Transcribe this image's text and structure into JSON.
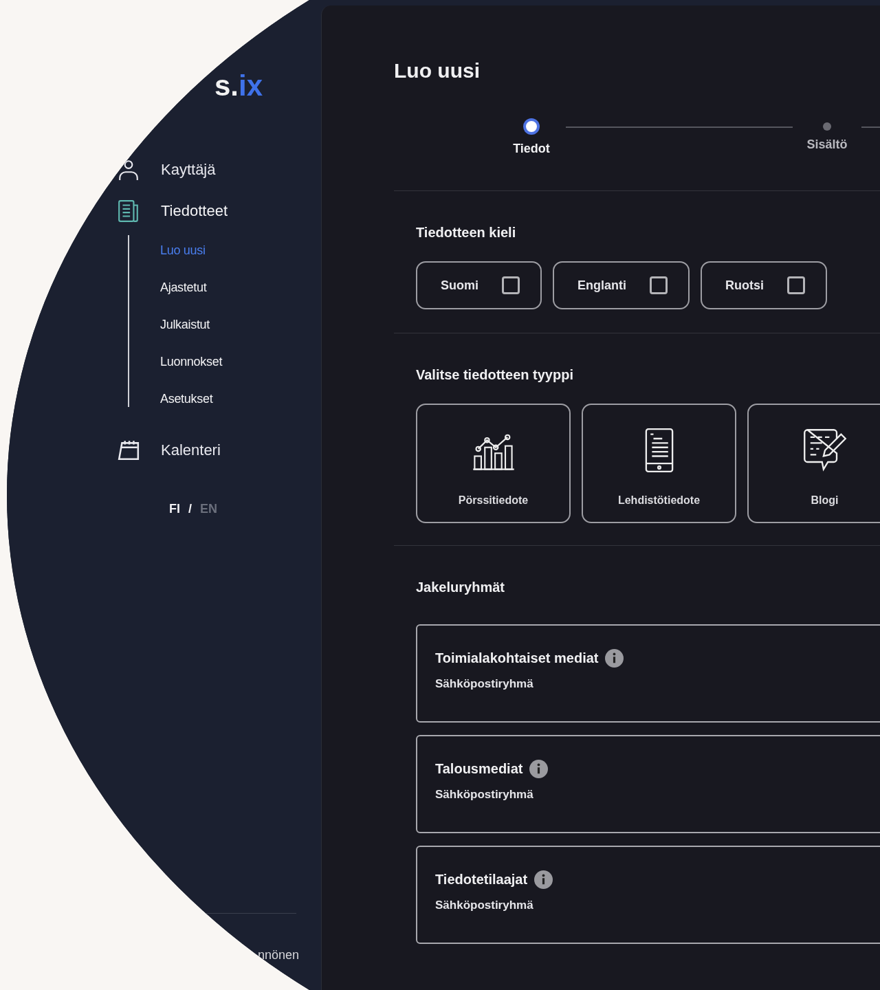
{
  "sidebar": {
    "logo_main": "s.",
    "logo_accent": "ix",
    "nav": [
      {
        "label": "Kayttäjä",
        "kind": "user",
        "selected": false
      },
      {
        "label": "Tiedotteet",
        "kind": "news",
        "selected": true,
        "children": [
          {
            "label": "Luo uusi",
            "selected": true
          },
          {
            "label": "Ajastetut",
            "selected": false
          },
          {
            "label": "Julkaistut",
            "selected": false
          },
          {
            "label": "Luonnokset",
            "selected": false
          },
          {
            "label": "Asetukset",
            "selected": false
          }
        ]
      },
      {
        "label": "Kalenteri",
        "kind": "calendar",
        "selected": false
      }
    ],
    "languages": [
      {
        "label": "FI",
        "selected": true
      },
      {
        "label": "EN",
        "selected": false
      }
    ],
    "language_separator": "/",
    "user_name": "nnönen"
  },
  "page": {
    "title": "Luo uusi",
    "steps": [
      {
        "label": "Tiedot",
        "selected": true
      },
      {
        "label": "Sisältö",
        "selected": false
      }
    ],
    "language_section": {
      "heading": "Tiedotteen kieli",
      "options": [
        {
          "label": "Suomi",
          "checked": false
        },
        {
          "label": "Englanti",
          "checked": false
        },
        {
          "label": "Ruotsi",
          "checked": false
        }
      ]
    },
    "type_section": {
      "heading": "Valitse tiedotteen tyyppi",
      "options": [
        {
          "label": "Pörssitiedote",
          "kind": "chart",
          "selected": false
        },
        {
          "label": "Lehdistötiedote",
          "kind": "tablet",
          "selected": false
        },
        {
          "label": "Blogi",
          "kind": "blog",
          "selected": false
        }
      ]
    },
    "groups_section": {
      "heading": "Jakeluryhmät",
      "groups": [
        {
          "title": "Toimialakohtaiset mediat",
          "subtitle": "Sähköpostiryhmä"
        },
        {
          "title": "Talousmediat",
          "subtitle": "Sähköpostiryhmä"
        },
        {
          "title": "Tiedotetilaajat",
          "subtitle": "Sähköpostiryhmä"
        }
      ]
    }
  }
}
